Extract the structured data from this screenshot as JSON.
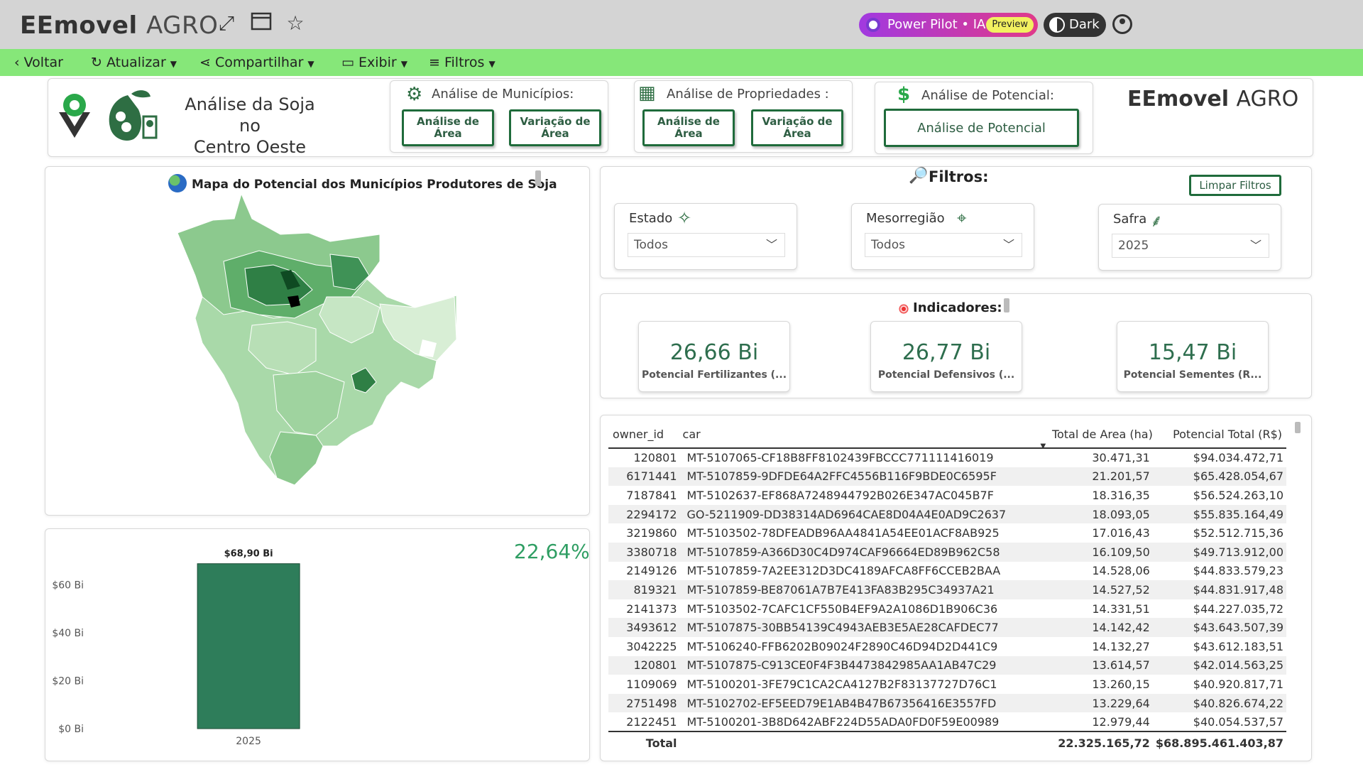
{
  "app": {
    "logo_main": "EEmovel",
    "logo_agro": "AGRO",
    "power_pilot": "Power Pilot • IA",
    "preview_badge": "Preview",
    "theme_toggle": "Dark"
  },
  "commandbar": {
    "back": "Voltar",
    "refresh": "Atualizar",
    "share": "Compartilhar",
    "view": "Exibir",
    "filters": "Filtros"
  },
  "header": {
    "title_line1": "Análise da Soja no",
    "title_line2": "Centro Oeste",
    "municipios_title": "Análise de Municípios:",
    "municipios_btn1": "Análise de Área",
    "municipios_btn2": "Variação de Área",
    "propriedades_title": "Análise de Propriedades :",
    "propriedades_btn1": "Análise de Área",
    "propriedades_btn2": "Variação de Área",
    "potencial_title": "Análise de Potencial:",
    "potencial_btn": "Análise de Potencial",
    "brand_main": "EEmovel",
    "brand_agro": "AGRO"
  },
  "map": {
    "title": "Mapa do Potencial dos Municípios Produtores de Soja"
  },
  "filters": {
    "title": "Filtros:",
    "clear": "Limpar Filtros",
    "estado_label": "Estado",
    "estado_value": "Todos",
    "meso_label": "Mesorregião",
    "meso_value": "Todos",
    "safra_label": "Safra",
    "safra_value": "2025"
  },
  "indicators": {
    "title": "Indicadores:",
    "kpi1_value": "26,66 Bi",
    "kpi1_caption": "Potencial Fertilizantes (...",
    "kpi2_value": "26,77 Bi",
    "kpi2_caption": "Potencial Defensivos (...",
    "kpi3_value": "15,47 Bi",
    "kpi3_caption": "Potencial Sementes (R..."
  },
  "bar_chart": {
    "percent": "22,64%"
  },
  "chart_data": {
    "type": "bar",
    "categories": [
      "2025"
    ],
    "values": [
      68.9
    ],
    "data_labels": [
      "$68,90 Bi"
    ],
    "ytick_labels": [
      "$0 Bi",
      "$20 Bi",
      "$40 Bi",
      "$60 Bi"
    ],
    "ylim": [
      0,
      70
    ],
    "bar_color": "#2e7d5a",
    "grid": false
  },
  "table": {
    "columns": [
      "owner_id",
      "car",
      "Total de Area (ha)",
      "Potencial Total (R$)"
    ],
    "rows": [
      [
        "120801",
        "MT-5107065-CF18B8FF8102439FBCCC771111416019",
        "30.471,31",
        "$94.034.472,71"
      ],
      [
        "6171441",
        "MT-5107859-9DFDE64A2FFC4556B116F9BDE0C6595F",
        "21.201,57",
        "$65.428.054,67"
      ],
      [
        "7187841",
        "MT-5102637-EF868A7248944792B026E347AC045B7F",
        "18.316,35",
        "$56.524.263,10"
      ],
      [
        "2294172",
        "GO-5211909-DD38314AD6964CAE8D04A4E0AD9C2637",
        "18.093,05",
        "$55.835.164,49"
      ],
      [
        "3219860",
        "MT-5103502-78DFEADB96AA4841A54EE01ACF8AB925",
        "17.016,43",
        "$52.512.715,36"
      ],
      [
        "3380718",
        "MT-5107859-A366D30C4D974CAF96664ED89B962C58",
        "16.109,50",
        "$49.713.912,00"
      ],
      [
        "2149126",
        "MT-5107859-7A2EE312D3DC4189AFCA8FF6CCEB2BAA",
        "14.528,06",
        "$44.833.579,23"
      ],
      [
        "819321",
        "MT-5107859-BE87061A7B7E413FA83B295C34937A21",
        "14.527,52",
        "$44.831.917,48"
      ],
      [
        "2141373",
        "MT-5103502-7CAFC1CF550B4EF9A2A1086D1B906C36",
        "14.331,51",
        "$44.227.035,72"
      ],
      [
        "3493612",
        "MT-5107875-30BB54139C4943AEB3E5AE28CAFDEC77",
        "14.142,42",
        "$43.643.507,39"
      ],
      [
        "3042225",
        "MT-5106240-FFB6202B09024F2890C46D94D2D441C9",
        "14.132,27",
        "$43.612.183,51"
      ],
      [
        "120801",
        "MT-5107875-C913CE0F4F3B4473842985AA1AB47C29",
        "13.614,57",
        "$42.014.563,25"
      ],
      [
        "1109069",
        "MT-5100201-3FE79C1CA2CA4127B2F83137727D76C1",
        "13.260,15",
        "$40.920.817,71"
      ],
      [
        "2751498",
        "MT-5102702-EF5EED79E1AB4B47B67356416E3557FD",
        "13.229,64",
        "$40.826.674,22"
      ],
      [
        "2122451",
        "MT-5100201-3B8D642ABF224D55ADA0FD0F59E00989",
        "12.979,44",
        "$40.054.537,57"
      ]
    ],
    "total_label": "Total",
    "total_area": "22.325.165,72",
    "total_potencial": "$68.895.461.403,87"
  }
}
